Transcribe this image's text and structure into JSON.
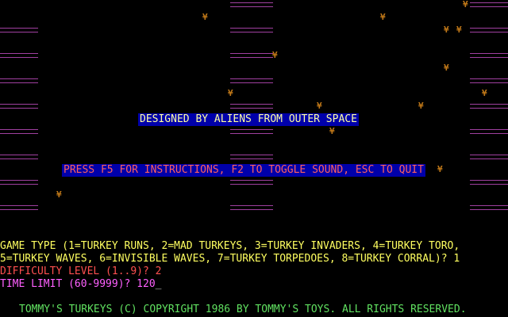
{
  "colors": {
    "background": "#000000",
    "lane": "#a040a0",
    "turkey": "#c07818",
    "banner_bg": "#0000aa",
    "banner1_text": "#ffffa0",
    "banner2_text": "#ff6060",
    "prompt_yellow": "#ffff60",
    "prompt_red": "#ff5050",
    "prompt_magenta": "#ff60ff",
    "footer_green": "#60e060"
  },
  "turkey_glyph": "¥",
  "banners": {
    "designed_by": "DESIGNED BY ALIENS FROM OUTER SPACE",
    "instructions": "PRESS F5 FOR INSTRUCTIONS, F2 TO TOGGLE SOUND, ESC TO QUIT"
  },
  "prompts": {
    "game_type_line1": "GAME TYPE (1=TURKEY RUNS, 2=MAD TURKEYS, 3=TURKEY INVADERS, 4=TURKEY TORO,",
    "game_type_line2": "5=TURKEY WAVES, 6=INVISIBLE WAVES, 7=TURKEY TORPEDOES, 8=TURKEY CORRAL)? 1",
    "difficulty": "DIFFICULTY LEVEL (1..9)? 2",
    "time_limit": "TIME LIMIT (60-9999)? 120",
    "cursor": "_"
  },
  "footer": "TOMMY'S TURKEYS (C) COPYRIGHT 1986 BY TOMMY'S TOYS. ALL RIGHTS RESERVED."
}
